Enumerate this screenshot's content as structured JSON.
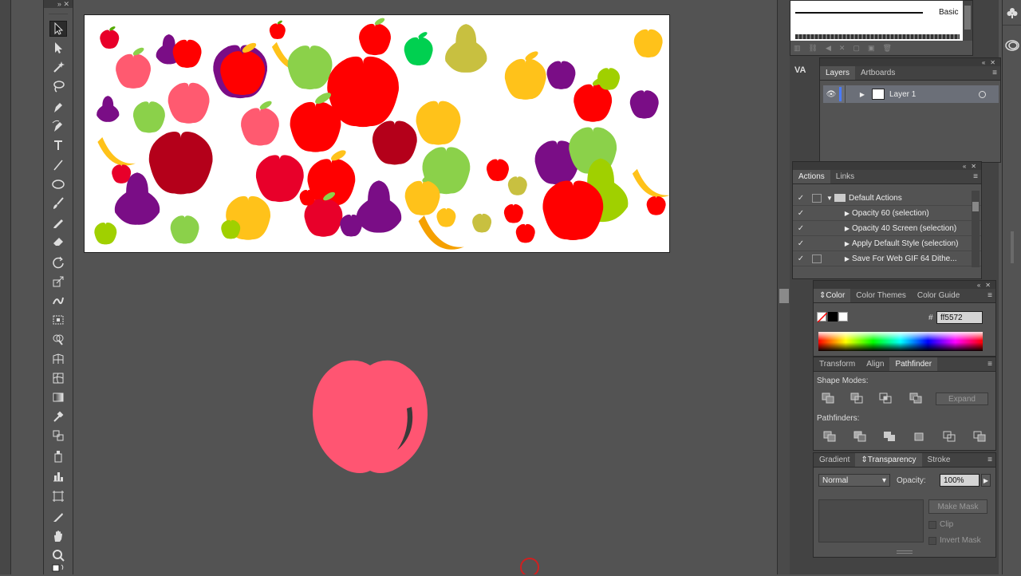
{
  "brush_panel": {
    "label": "Basic"
  },
  "layers_panel": {
    "tabs": [
      "Layers",
      "Artboards"
    ],
    "active_tab": "Layers",
    "layer_name": "Layer 1"
  },
  "actions_panel": {
    "tabs": [
      "Actions",
      "Links"
    ],
    "active_tab": "Actions",
    "items": [
      {
        "label": "Default Actions",
        "type": "folder"
      },
      {
        "label": "Opacity 60 (selection)",
        "type": "action"
      },
      {
        "label": "Opacity 40 Screen (selection)",
        "type": "action"
      },
      {
        "label": "Apply Default Style (selection)",
        "type": "action"
      },
      {
        "label": "Save For Web GIF 64 Dithe...",
        "type": "action"
      }
    ]
  },
  "color_panel": {
    "tabs": [
      "Color",
      "Color Themes",
      "Color Guide"
    ],
    "active_tab": "Color",
    "hash": "#",
    "hex_value": "ff5572"
  },
  "pathfinder_panel": {
    "tabs": [
      "Transform",
      "Align",
      "Pathfinder"
    ],
    "active_tab": "Pathfinder",
    "shape_modes_label": "Shape Modes:",
    "expand_label": "Expand",
    "pathfinders_label": "Pathfinders:"
  },
  "transparency_panel": {
    "tabs": [
      "Gradient",
      "Transparency",
      "Stroke"
    ],
    "active_tab": "Transparency",
    "blend_mode": "Normal",
    "opacity_label": "Opacity:",
    "opacity_value": "100%",
    "make_mask_label": "Make Mask",
    "clip_label": "Clip",
    "invert_mask_label": "Invert Mask"
  },
  "colors": {
    "canvas_bg": "#535353",
    "selected_apple": "#ff5572",
    "panel_bg": "#535353"
  },
  "tools": [
    "selection-tool",
    "direct-selection-tool",
    "magic-wand-tool",
    "lasso-tool",
    "pen-tool",
    "curvature-tool",
    "type-tool",
    "line-tool",
    "ellipse-tool",
    "paintbrush-tool",
    "pencil-tool",
    "eraser-tool",
    "rotate-tool",
    "scale-tool",
    "warp-tool",
    "free-transform-tool",
    "shape-builder-tool",
    "perspective-grid-tool",
    "mesh-tool",
    "gradient-tool",
    "eyedropper-tool",
    "blend-tool",
    "symbol-sprayer-tool",
    "column-graph-tool",
    "artboard-tool",
    "slice-tool",
    "hand-tool",
    "zoom-tool"
  ]
}
